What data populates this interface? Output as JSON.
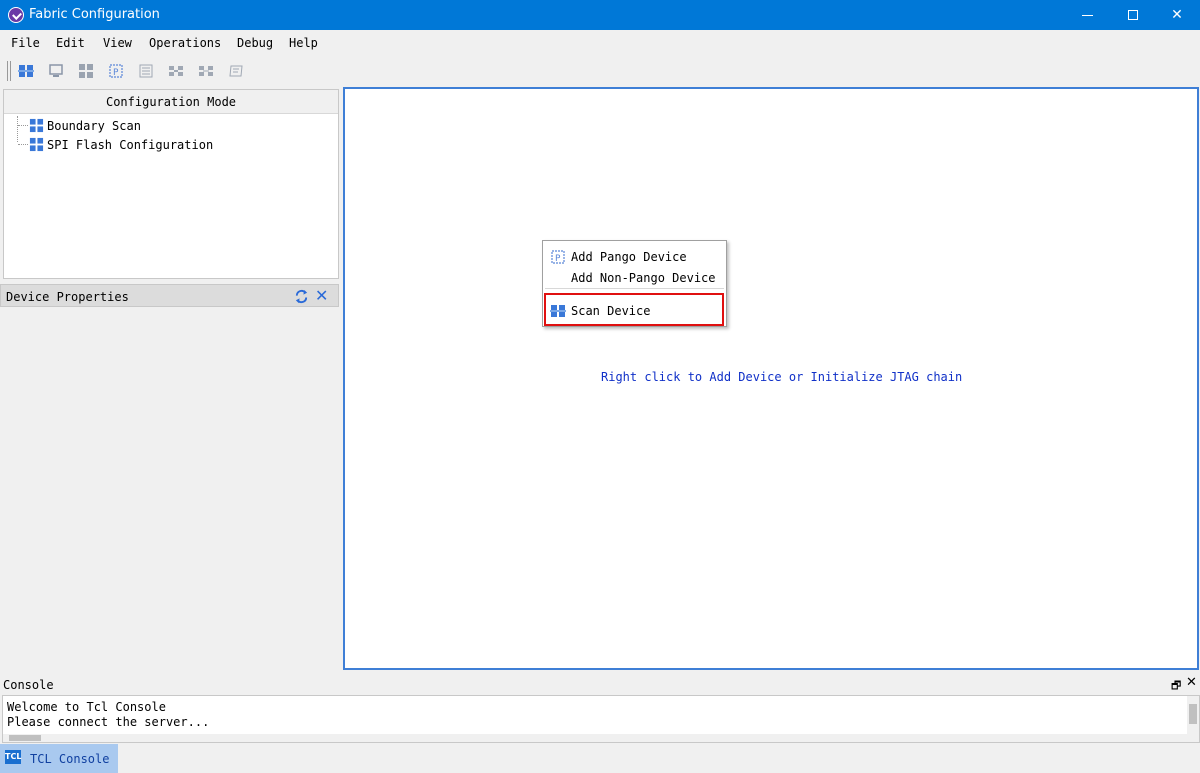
{
  "window": {
    "title": "Fabric Configuration",
    "accent": "#0078d7"
  },
  "menubar": {
    "items": [
      "File",
      "Edit",
      "View",
      "Operations",
      "Debug",
      "Help"
    ]
  },
  "toolbar": {
    "icons": [
      "scan-chain-icon",
      "monitor-icon",
      "grid-icon",
      "pango-device-icon",
      "list-icon",
      "chain-icon",
      "chain-alt-icon",
      "device-outline-icon"
    ]
  },
  "config_panel": {
    "header": "Configuration Mode",
    "items": [
      {
        "label": "Boundary Scan",
        "icon": "boundary-scan-icon"
      },
      {
        "label": "SPI Flash Configuration",
        "icon": "spi-flash-icon"
      }
    ]
  },
  "device_properties": {
    "header": "Device Properties"
  },
  "canvas": {
    "hint": "Right click to Add Device or Initialize JTAG chain",
    "hint_color": "#1030c8"
  },
  "context_menu": {
    "items": [
      {
        "label": "Add Pango Device",
        "icon": "pango-device-icon"
      },
      {
        "label": "Add Non-Pango Device",
        "icon": ""
      },
      {
        "label": "Scan Device",
        "icon": "scan-device-icon"
      }
    ],
    "highlight_color": "#e01010"
  },
  "console": {
    "header": "Console",
    "lines": [
      "Welcome to Tcl Console",
      "Please connect the server..."
    ],
    "tab_label": "TCL Console",
    "tab_icon_text": "TCL"
  }
}
